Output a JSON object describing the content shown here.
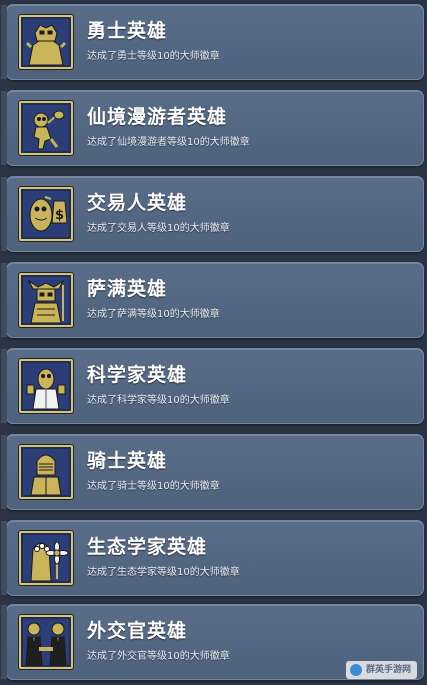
{
  "achievements": [
    {
      "title": "勇士英雄",
      "desc": "达成了勇士等级10的大师徽章",
      "icon": "warrior-icon"
    },
    {
      "title": "仙境漫游者英雄",
      "desc": "达成了仙境漫游者等级10的大师徽章",
      "icon": "wanderer-icon"
    },
    {
      "title": "交易人英雄",
      "desc": "达成了交易人等级10的大师徽章",
      "icon": "trader-icon"
    },
    {
      "title": "萨满英雄",
      "desc": "达成了萨满等级10的大师徽章",
      "icon": "shaman-icon"
    },
    {
      "title": "科学家英雄",
      "desc": "达成了科学家等级10的大师徽章",
      "icon": "scientist-icon"
    },
    {
      "title": "骑士英雄",
      "desc": "达成了骑士等级10的大师徽章",
      "icon": "knight-icon"
    },
    {
      "title": "生态学家英雄",
      "desc": "达成了生态学家等级10的大师徽章",
      "icon": "ecologist-icon"
    },
    {
      "title": "外交官英雄",
      "desc": "达成了外交官等级10的大师徽章",
      "icon": "diplomat-icon"
    }
  ],
  "watermark": "群英手游网",
  "colors": {
    "badge_bg": "#2b3e77",
    "badge_border": "#d9c46a",
    "figure": "#c9b45a",
    "card": "#566a86"
  }
}
